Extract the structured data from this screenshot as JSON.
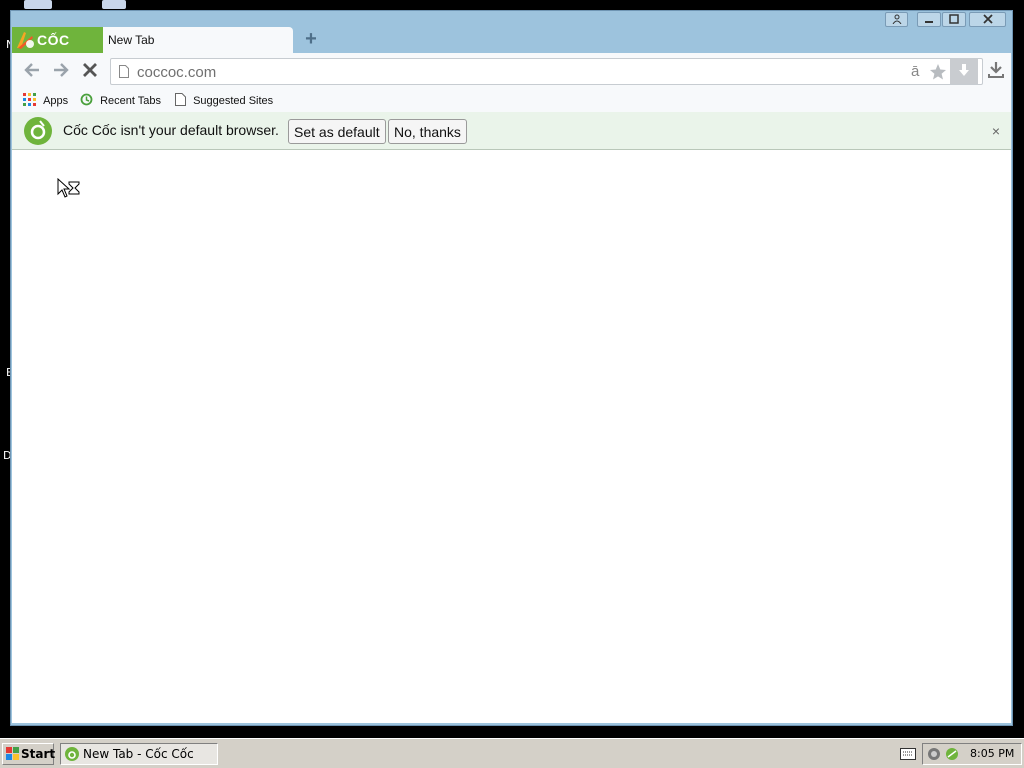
{
  "desktop": {
    "letters": [
      "N",
      "E",
      "D"
    ]
  },
  "browser": {
    "logo_text": "CỐC CỐC",
    "tab_title": "New Tab",
    "new_tab_symbol": "+",
    "window_controls": [
      "profile-icon",
      "minimize-icon",
      "maximize-icon",
      "close-icon"
    ],
    "address": "coccoc.com",
    "bookmarks": [
      {
        "label": "Apps",
        "icon": "apps-grid-icon"
      },
      {
        "label": "Recent Tabs",
        "icon": "recent-tabs-icon"
      },
      {
        "label": "Suggested Sites",
        "icon": "page-icon"
      }
    ],
    "infobar": {
      "message": "Cốc Cốc isn't your default browser.",
      "set_default": "Set as default",
      "no_thanks": "No, thanks",
      "close": "×"
    },
    "colors": {
      "accent": "#6fb43c",
      "frame": "#9dc3dd",
      "infobar": "#eaf4ea"
    }
  },
  "taskbar": {
    "start_label": "Start",
    "task_label": "New Tab - Cốc Cốc",
    "clock": "8:05 PM"
  }
}
